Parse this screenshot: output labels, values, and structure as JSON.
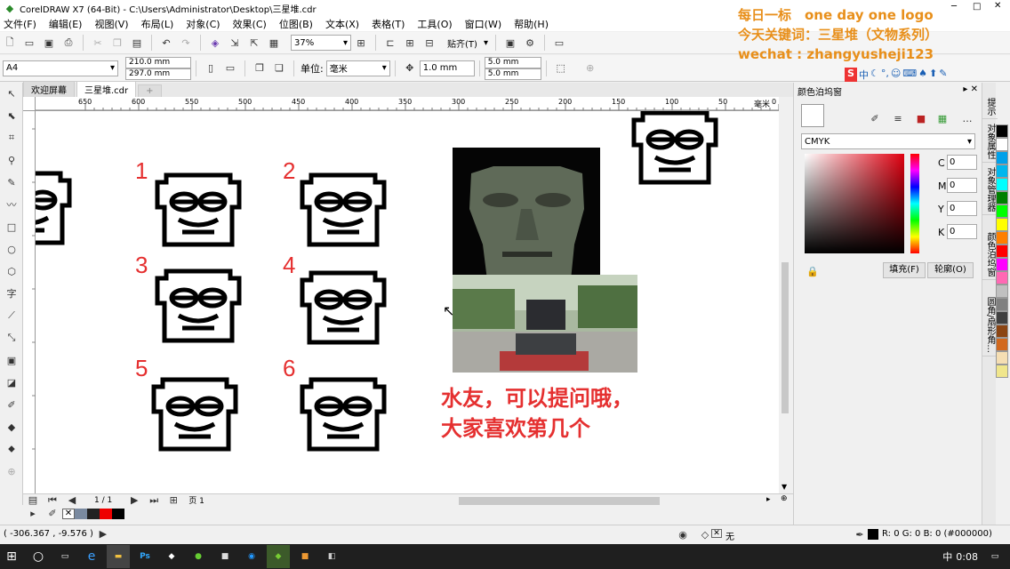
{
  "window": {
    "title": "CorelDRAW X7 (64-Bit) - C:\\Users\\Administrator\\Desktop\\三星堆.cdr"
  },
  "menu": [
    "文件(F)",
    "编辑(E)",
    "视图(V)",
    "布局(L)",
    "对象(C)",
    "效果(C)",
    "位图(B)",
    "文本(X)",
    "表格(T)",
    "工具(O)",
    "窗口(W)",
    "帮助(H)"
  ],
  "toolbar": {
    "zoom": "37%",
    "snap": "贴齐(T)"
  },
  "propbar": {
    "page_size": "A4",
    "width": "210.0 mm",
    "height": "297.0 mm",
    "units_label": "单位:",
    "units": "毫米",
    "nudge": "1.0 mm",
    "dup_x": "5.0 mm",
    "dup_y": "5.0 mm"
  },
  "doc_tabs": [
    "欢迎屏幕",
    "三星堆.cdr"
  ],
  "ruler": {
    "unit": "毫米",
    "ticks": [
      "650",
      "600",
      "550",
      "500",
      "450",
      "400",
      "350",
      "300",
      "250",
      "200",
      "150",
      "100",
      "50",
      "0"
    ]
  },
  "overlay": {
    "line1": "每日一标　one day one logo",
    "line2": "今天关键词：三星堆（文物系列）",
    "line3": "wechat : zhangyusheji123"
  },
  "canvas": {
    "numbers": [
      "1",
      "2",
      "3",
      "4",
      "5",
      "6"
    ],
    "caption1": "水友，可以提问哦，",
    "caption2": "大家喜欢第几个"
  },
  "page_nav": {
    "count": "1 / 1",
    "page": "页 1"
  },
  "docker": {
    "title": "颜色泊坞窗",
    "model": "CMYK",
    "c_label": "C",
    "m_label": "M",
    "y_label": "Y",
    "k_label": "K",
    "c": "0",
    "m": "0",
    "y": "0",
    "k": "0",
    "fill_btn": "填充(F)",
    "outline_btn": "轮廓(O)"
  },
  "docker_tabs": [
    "提示",
    "对象属性",
    "对象管理器",
    "颜色泊坞窗",
    "圆角/扇形角..."
  ],
  "status": {
    "coords": "( -306.367 , -9.576 )",
    "fill_label": "无",
    "color_info": "R: 0 G: 0 B: 0 (#000000)"
  },
  "taskbar": {
    "time": "0:08",
    "lang": "中",
    "ps": "Ps"
  },
  "colors": {
    "swatches": [
      "#000000",
      "#ffffff",
      "#00a0e9",
      "#00b7ee",
      "#00ffff",
      "#008000",
      "#00ff00",
      "#ffff00",
      "#ff7f00",
      "#ff0000",
      "#ff00ff",
      "#ff69b4",
      "#c0c0c0",
      "#808080",
      "#404040",
      "#8b4513",
      "#d2691e",
      "#f5deb3",
      "#f0e68c"
    ]
  }
}
